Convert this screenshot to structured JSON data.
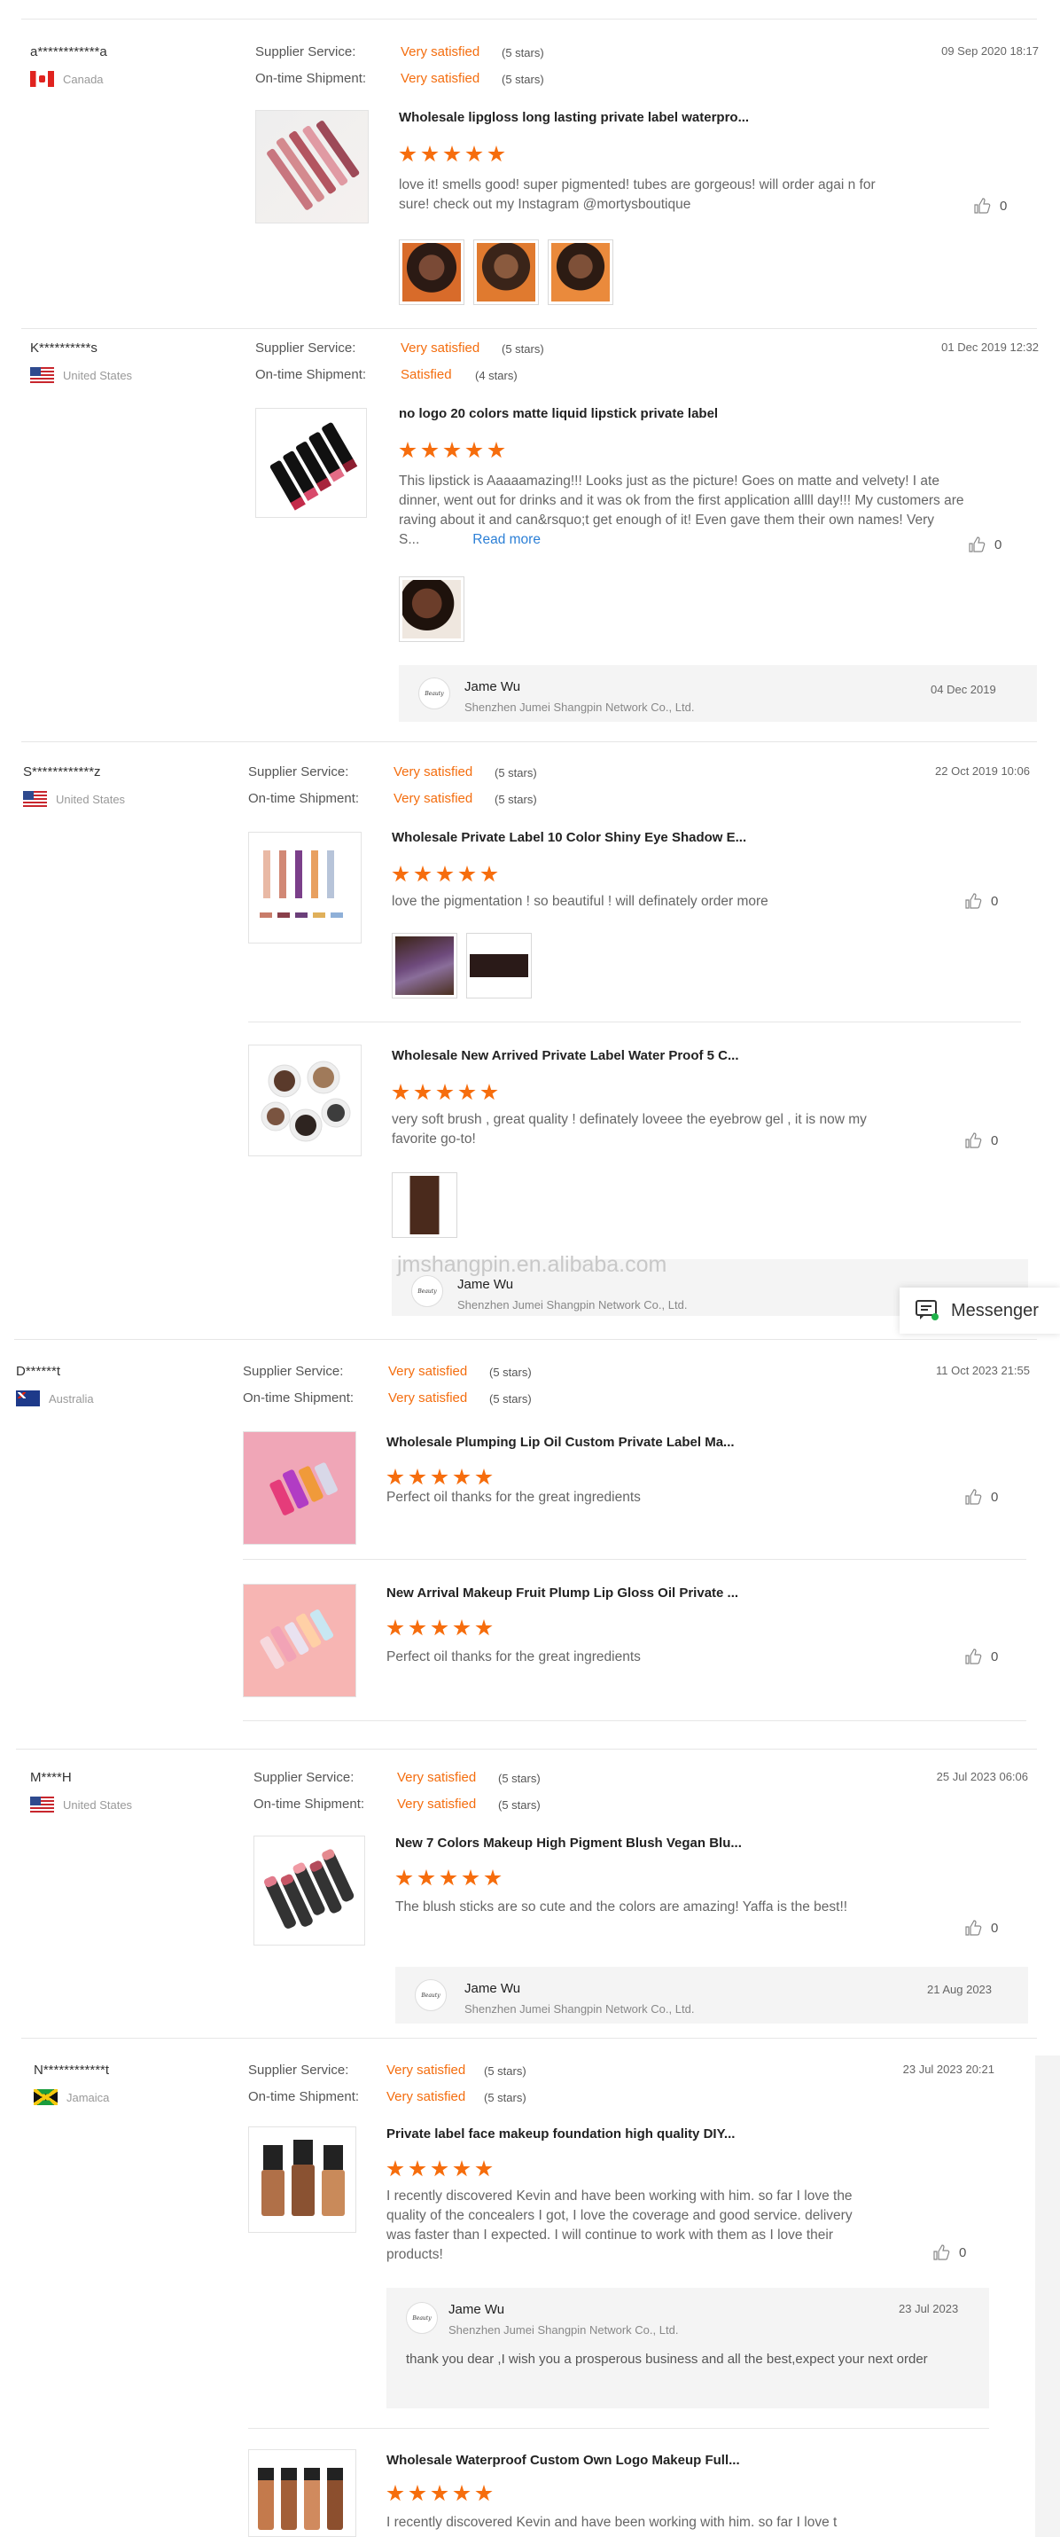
{
  "labels": {
    "supplier_service": "Supplier Service:",
    "on_time_shipment": "On-time Shipment:",
    "read_more": "Read more"
  },
  "messenger": {
    "label": "Messenger"
  },
  "watermark": "jmshangpin.en.alibaba.com",
  "reviews": [
    {
      "buyer": "a************a",
      "country": "Canada",
      "flag": "flag-ca",
      "supplier_service": "Very satisfied",
      "supplier_service_stars": "(5 stars)",
      "on_time_shipment": "Very satisfied",
      "on_time_shipment_stars": "(5 stars)",
      "date": "09 Sep 2020 18:17",
      "items": [
        {
          "title": "Wholesale lipgloss long lasting private label waterpro...",
          "rating": 5,
          "comment": "love it! smells good! super pigmented! tubes are gorgeous! will order agai n for sure! check out my Instagram @mortysboutique",
          "likes": "0"
        }
      ]
    },
    {
      "buyer": "K**********s",
      "country": "United States",
      "flag": "flag-us",
      "supplier_service": "Very satisfied",
      "supplier_service_stars": "(5 stars)",
      "on_time_shipment": "Satisfied",
      "on_time_shipment_stars": "(4 stars)",
      "date": "01 Dec 2019 12:32",
      "items": [
        {
          "title": "no logo 20 colors matte liquid lipstick private label",
          "rating": 5,
          "comment": "This lipstick is Aaaaamazing!!! Looks just as the picture! Goes on matte and velvety! I ate dinner, went out for drinks and it was ok from the first application allll day!!! My customers are raving about it and can&rsquo;t get enough of it! Even gave them their own names! Very S...",
          "likes": "0"
        }
      ],
      "reply": {
        "name": "Jame Wu",
        "company": "Shenzhen Jumei Shangpin Network Co., Ltd.",
        "date": "04 Dec 2019"
      }
    },
    {
      "buyer": "S************z",
      "country": "United States",
      "flag": "flag-us",
      "supplier_service": "Very satisfied",
      "supplier_service_stars": "(5 stars)",
      "on_time_shipment": "Very satisfied",
      "on_time_shipment_stars": "(5 stars)",
      "date": "22 Oct 2019 10:06",
      "items": [
        {
          "title": "Wholesale Private Label 10 Color Shiny Eye Shadow E...",
          "rating": 5,
          "comment": "love the pigmentation ! so beautiful ! will definately order more",
          "likes": "0"
        },
        {
          "title": "Wholesale New Arrived Private Label Water Proof 5 C...",
          "rating": 5,
          "comment": "very soft brush , great quality ! definately loveee the eyebrow gel , it is now my favorite go-to!",
          "likes": "0"
        }
      ],
      "reply": {
        "name": "Jame Wu",
        "company": "Shenzhen Jumei Shangpin Network Co., Ltd."
      }
    },
    {
      "buyer": "D******t",
      "country": "Australia",
      "flag": "flag-au",
      "supplier_service": "Very satisfied",
      "supplier_service_stars": "(5 stars)",
      "on_time_shipment": "Very satisfied",
      "on_time_shipment_stars": "(5 stars)",
      "date": "11 Oct 2023 21:55",
      "items": [
        {
          "title": "Wholesale Plumping Lip Oil Custom Private Label Ma...",
          "rating": 5,
          "comment": "Perfect oil thanks for the great ingredients",
          "likes": "0"
        },
        {
          "title": "New Arrival Makeup Fruit Plump Lip Gloss Oil Private ...",
          "rating": 5,
          "comment": "Perfect oil thanks for the great ingredients",
          "likes": "0"
        }
      ]
    },
    {
      "buyer": "M****H",
      "country": "United States",
      "flag": "flag-us",
      "supplier_service": "Very satisfied",
      "supplier_service_stars": "(5 stars)",
      "on_time_shipment": "Very satisfied",
      "on_time_shipment_stars": "(5 stars)",
      "date": "25 Jul 2023 06:06",
      "items": [
        {
          "title": "New 7 Colors Makeup High Pigment Blush Vegan Blu...",
          "rating": 5,
          "comment": "The blush sticks are so cute and the colors are amazing! Yaffa is the best!!",
          "likes": "0"
        }
      ],
      "reply": {
        "name": "Jame Wu",
        "company": "Shenzhen Jumei Shangpin Network Co., Ltd.",
        "date": "21 Aug 2023"
      }
    },
    {
      "buyer": "N************t",
      "country": "Jamaica",
      "flag": "flag-jm",
      "supplier_service": "Very satisfied",
      "supplier_service_stars": "(5 stars)",
      "on_time_shipment": "Very satisfied",
      "on_time_shipment_stars": "(5 stars)",
      "date": "23 Jul 2023 20:21",
      "items": [
        {
          "title": "Private label face makeup foundation high quality DIY...",
          "rating": 5,
          "comment": "I recently discovered Kevin and have been working with him. so far I love the quality of the concealers I got, I love the coverage and good service. delivery was faster than I expected. I will continue to work with them as I love their products!",
          "likes": "0"
        },
        {
          "title": "Wholesale Waterproof Custom Own Logo Makeup Full...",
          "rating": 5,
          "comment": "I recently discovered Kevin and have been working with him. so far I love t"
        }
      ],
      "reply": {
        "name": "Jame Wu",
        "company": "Shenzhen Jumei Shangpin Network Co., Ltd.",
        "date": "23 Jul 2023",
        "text": "thank you dear ,I wish you a prosperous business and all the best,expect your next order"
      }
    }
  ],
  "colors": {
    "accent": "#f46d0e",
    "link": "#2b7fd6",
    "star": "#f66d0d"
  }
}
